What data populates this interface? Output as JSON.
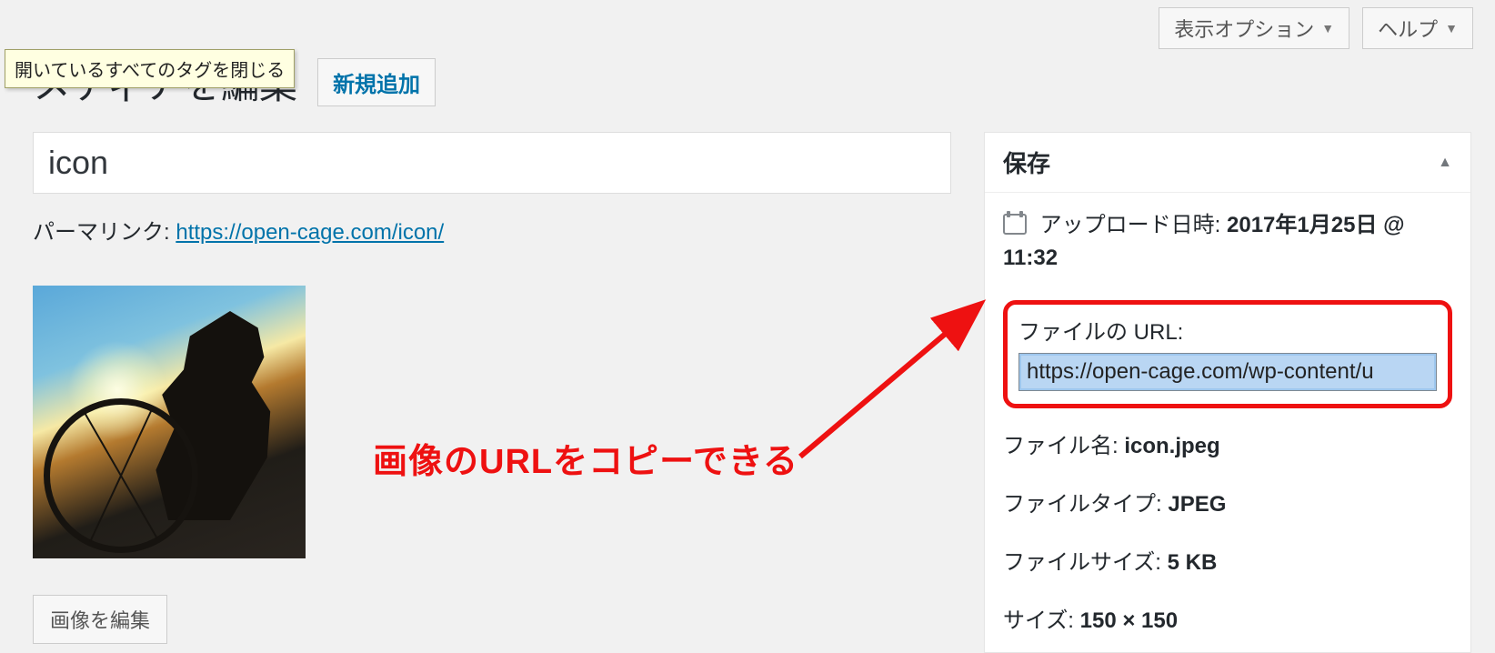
{
  "topbar": {
    "screen_options": "表示オプション",
    "help": "ヘルプ"
  },
  "header": {
    "page_title": "メディアを編集",
    "add_new": "新規追加",
    "tooltip": "開いているすべてのタグを閉じる"
  },
  "main": {
    "title_value": "icon",
    "permalink_label": "パーマリンク:",
    "permalink_url": "https://open-cage.com/icon/",
    "edit_image": "画像を編集"
  },
  "sidebar": {
    "save_heading": "保存",
    "uploaded_label": "アップロード日時:",
    "uploaded_value": "2017年1月25日 @ 11:32",
    "file_url_label": "ファイルの URL:",
    "file_url_value": "https://open-cage.com/wp-content/u",
    "file_name_label": "ファイル名:",
    "file_name_value": "icon.jpeg",
    "file_type_label": "ファイルタイプ:",
    "file_type_value": "JPEG",
    "file_size_label": "ファイルサイズ:",
    "file_size_value": "5 KB",
    "dimensions_label": "サイズ:",
    "dimensions_value": "150 × 150"
  },
  "annotation": {
    "text": "画像のURLをコピーできる"
  }
}
